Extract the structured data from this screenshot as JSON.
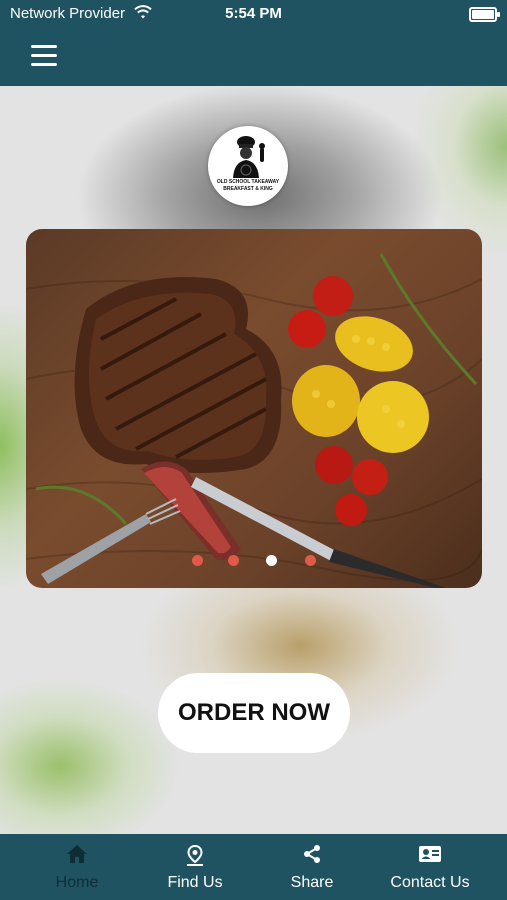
{
  "status": {
    "provider": "Network Provider",
    "time": "5:54 PM"
  },
  "logo": {
    "line1": "OLD SCHOOL TAKEAWAY",
    "line2": "BREAKFAST & KING"
  },
  "carousel": {
    "dots": 4,
    "active_index": 2
  },
  "order_button": "ORDER NOW",
  "nav": {
    "items": [
      {
        "label": "Home",
        "icon": "home-icon",
        "active": true
      },
      {
        "label": "Find Us",
        "icon": "location-pin-icon",
        "active": false
      },
      {
        "label": "Share",
        "icon": "share-icon",
        "active": false
      },
      {
        "label": "Contact Us",
        "icon": "contact-card-icon",
        "active": false
      }
    ]
  },
  "colors": {
    "header_bg": "#1f5362",
    "active_nav_label": "#0f2d35",
    "dot_inactive": "#e05a4a",
    "dot_active": "#ffffff"
  }
}
